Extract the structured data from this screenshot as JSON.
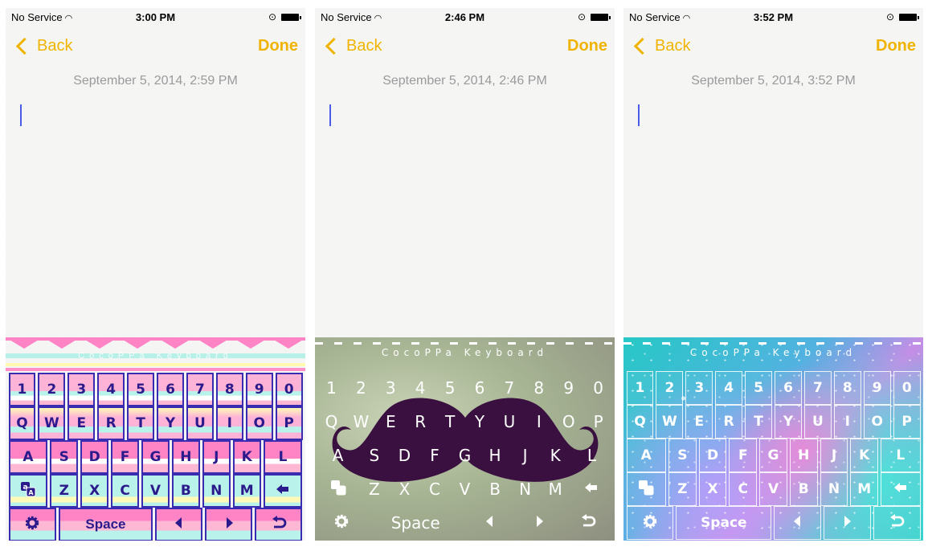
{
  "panels": [
    {
      "status": {
        "carrier": "No Service",
        "time": "3:00 PM"
      },
      "nav": {
        "back_label": "Back",
        "done_label": "Done"
      },
      "note": {
        "date": "September 5, 2014, 2:59 PM"
      },
      "keyboard": {
        "theme": "pastel-aztec",
        "title": "CocoPPa Keyboard"
      }
    },
    {
      "status": {
        "carrier": "No Service",
        "time": "2:46 PM"
      },
      "nav": {
        "back_label": "Back",
        "done_label": "Done"
      },
      "note": {
        "date": "September 5, 2014, 2:46 PM"
      },
      "keyboard": {
        "theme": "mustache",
        "title": "CocoPPa Keyboard"
      }
    },
    {
      "status": {
        "carrier": "No Service",
        "time": "3:52 PM"
      },
      "nav": {
        "back_label": "Back",
        "done_label": "Done"
      },
      "note": {
        "date": "September 5, 2014, 3:52 PM"
      },
      "keyboard": {
        "theme": "galaxy",
        "title": "CocoPPa Keyboard"
      }
    }
  ],
  "keyboard_layout": {
    "numbers": [
      "1",
      "2",
      "3",
      "4",
      "5",
      "6",
      "7",
      "8",
      "9",
      "0"
    ],
    "row1": [
      "Q",
      "W",
      "E",
      "R",
      "T",
      "Y",
      "U",
      "I",
      "O",
      "P"
    ],
    "row2": [
      "A",
      "S",
      "D",
      "F",
      "G",
      "H",
      "J",
      "K",
      "L"
    ],
    "row3": [
      "Z",
      "X",
      "C",
      "V",
      "B",
      "N",
      "M"
    ],
    "space_label": "Space",
    "icons": [
      "language-switch-icon",
      "backspace-icon",
      "settings-gear-icon",
      "cursor-left-icon",
      "cursor-right-icon",
      "return-icon"
    ]
  },
  "colors": {
    "accent": "#f0b400",
    "cursor": "#4a5bea",
    "date_text": "#9a9a9a",
    "pastel_key_border": "#3a2cb0",
    "pastel_key_text": "#2a1a8c",
    "mustache": "#3a1040"
  }
}
